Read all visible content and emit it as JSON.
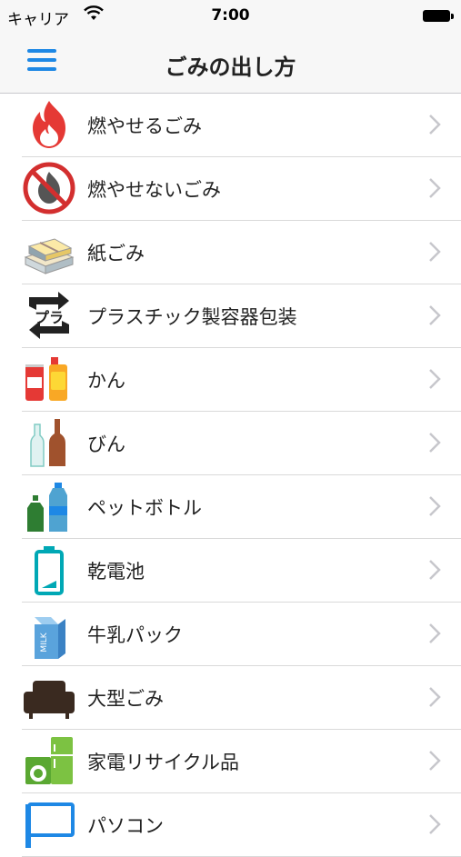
{
  "status_bar": {
    "carrier": "キャリア",
    "time": "7:00"
  },
  "nav": {
    "title": "ごみの出し方",
    "menu_icon": "hamburger-menu-icon"
  },
  "items": [
    {
      "label": "燃やせるごみ",
      "icon": "fire-icon"
    },
    {
      "label": "燃やせないごみ",
      "icon": "no-burn-icon"
    },
    {
      "label": "紙ごみ",
      "icon": "paper-bundle-icon"
    },
    {
      "label": "プラスチック製容器包装",
      "icon": "plastic-recycle-icon"
    },
    {
      "label": "かん",
      "icon": "can-icon"
    },
    {
      "label": "びん",
      "icon": "bottle-icon"
    },
    {
      "label": "ペットボトル",
      "icon": "pet-bottle-icon"
    },
    {
      "label": "乾電池",
      "icon": "battery-icon"
    },
    {
      "label": "牛乳パック",
      "icon": "milk-carton-icon"
    },
    {
      "label": "大型ごみ",
      "icon": "sofa-icon"
    },
    {
      "label": "家電リサイクル品",
      "icon": "appliance-icon"
    },
    {
      "label": "パソコン",
      "icon": "computer-icon"
    }
  ],
  "colors": {
    "accent": "#1e88e5",
    "fire": "#e53935",
    "chevron": "#c7c7cc"
  }
}
